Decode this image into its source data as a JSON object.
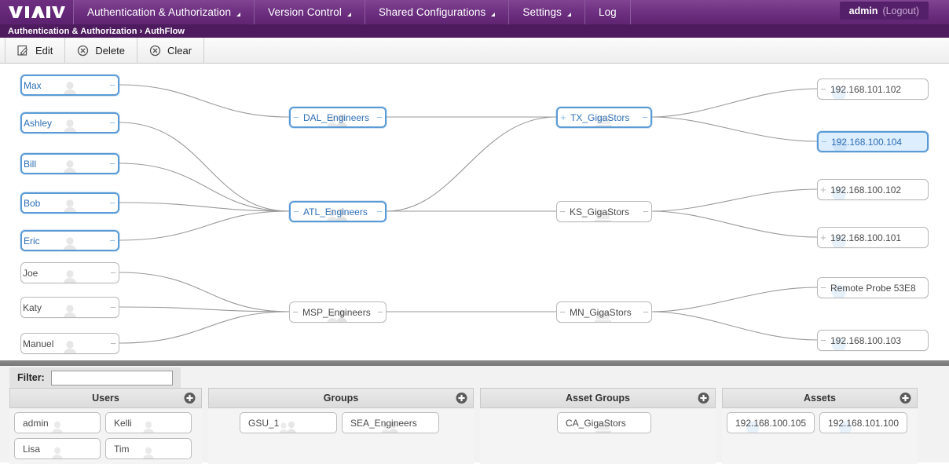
{
  "header": {
    "logo_text": "VIAVI",
    "menu": [
      {
        "label": "Authentication & Authorization",
        "has_caret": true
      },
      {
        "label": "Version Control",
        "has_caret": true
      },
      {
        "label": "Shared Configurations",
        "has_caret": true
      },
      {
        "label": "Settings",
        "has_caret": true
      },
      {
        "label": "Log",
        "has_caret": false
      }
    ],
    "user": {
      "name": "admin",
      "logout_label": "(Logout)"
    },
    "breadcrumb": "Authentication & Authorization › AuthFlow"
  },
  "toolbar": {
    "buttons": [
      {
        "label": "Edit",
        "icon": "edit-pencil-icon"
      },
      {
        "label": "Delete",
        "icon": "circle-x-icon"
      },
      {
        "label": "Clear",
        "icon": "circle-x-icon"
      }
    ]
  },
  "graph": {
    "users": [
      {
        "label": "Max",
        "selected": true,
        "right_handle": "−"
      },
      {
        "label": "Ashley",
        "selected": true,
        "right_handle": "−"
      },
      {
        "label": "Bill",
        "selected": true,
        "right_handle": "−"
      },
      {
        "label": "Bob",
        "selected": true,
        "right_handle": "−"
      },
      {
        "label": "Eric",
        "selected": true,
        "right_handle": "−"
      },
      {
        "label": "Joe",
        "selected": false,
        "right_handle": "−"
      },
      {
        "label": "Katy",
        "selected": false,
        "right_handle": "−"
      },
      {
        "label": "Manuel",
        "selected": false,
        "right_handle": "−"
      }
    ],
    "groups": [
      {
        "label": "DAL_Engineers",
        "selected": true,
        "left_handle": "−",
        "right_handle": "−"
      },
      {
        "label": "ATL_Engineers",
        "selected": true,
        "left_handle": "−",
        "right_handle": "−"
      },
      {
        "label": "MSP_Engineers",
        "selected": false,
        "left_handle": "−",
        "right_handle": "−"
      }
    ],
    "asset_groups": [
      {
        "label": "TX_GigaStors",
        "selected": true,
        "left_handle": "+",
        "right_handle": "−"
      },
      {
        "label": "KS_GigaStors",
        "selected": false,
        "left_handle": "−",
        "right_handle": "−"
      },
      {
        "label": "MN_GigaStors",
        "selected": false,
        "left_handle": "−",
        "right_handle": "−"
      }
    ],
    "assets": [
      {
        "label": "192.168.101.102",
        "selected": false,
        "filled": false,
        "left_handle": "−"
      },
      {
        "label": "192.168.100.104",
        "selected": true,
        "filled": true,
        "left_handle": "−"
      },
      {
        "label": "192.168.100.102",
        "selected": false,
        "filled": false,
        "left_handle": "+"
      },
      {
        "label": "192.168.100.101",
        "selected": false,
        "filled": false,
        "left_handle": "+"
      },
      {
        "label": "Remote Probe 53E8",
        "selected": false,
        "filled": false,
        "left_handle": "−"
      },
      {
        "label": "192.168.100.103",
        "selected": false,
        "filled": false,
        "left_handle": "−"
      }
    ]
  },
  "filter": {
    "label": "Filter:",
    "value": "",
    "placeholder": ""
  },
  "panels": [
    {
      "title": "Users",
      "add_label": "+",
      "items": [
        {
          "label": "admin"
        },
        {
          "label": "Kelli"
        },
        {
          "label": "Lisa"
        },
        {
          "label": "Tim"
        }
      ]
    },
    {
      "title": "Groups",
      "add_label": "+",
      "items": [
        {
          "label": "GSU_1"
        },
        {
          "label": "SEA_Engineers"
        }
      ]
    },
    {
      "title": "Asset Groups",
      "add_label": "+",
      "items": [
        {
          "label": "CA_GigaStors"
        }
      ]
    },
    {
      "title": "Assets",
      "add_label": "+",
      "items": [
        {
          "label": "192.168.100.105"
        },
        {
          "label": "192.168.101.100"
        }
      ]
    }
  ],
  "colors": {
    "brand_purple": "#6d2f80",
    "breadcrumb_purple": "#4d1b5e",
    "selected_blue": "#5b9bd5",
    "selected_text": "#2f6fb5",
    "selected_fill": "#ddeeff",
    "edge_gray": "#9a9a9a"
  }
}
